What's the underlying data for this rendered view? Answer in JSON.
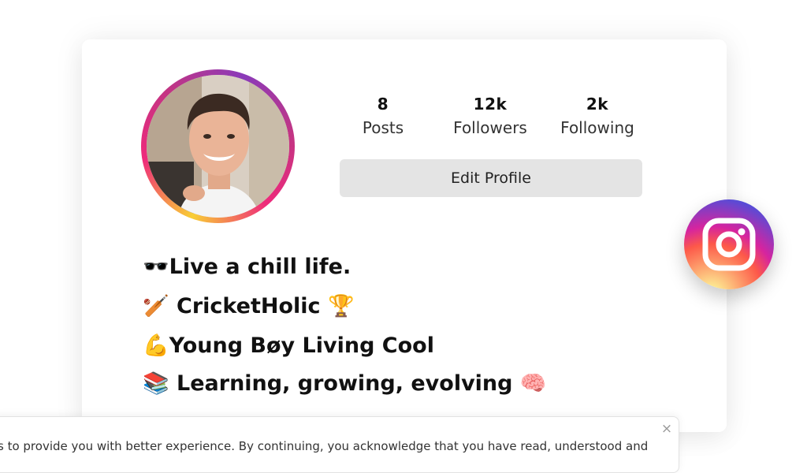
{
  "profile": {
    "stats": [
      {
        "value": "8",
        "label": "Posts"
      },
      {
        "value": "12k",
        "label": "Followers"
      },
      {
        "value": "2k",
        "label": "Following"
      }
    ],
    "edit_button_label": "Edit Profile",
    "bio": [
      {
        "emoji": "🕶️",
        "text": "Live a chill life."
      },
      {
        "emoji": "🏏",
        "text": " CricketHolic ",
        "trailing_emoji": "🏆"
      },
      {
        "emoji": "💪",
        "text": "Young Bøy Living Cool"
      },
      {
        "emoji": "📚",
        "text": " Learning, growing, evolving ",
        "trailing_emoji": "🧠"
      }
    ]
  },
  "instagram_badge": {
    "icon": "instagram-logo-icon",
    "gradient": [
      "#fdf497",
      "#fd5949",
      "#d6249f",
      "#285AEB"
    ]
  },
  "cookie_banner": {
    "text": "s to provide you with better experience. By continuing, you acknowledge that you have read, understood and",
    "close_symbol": "×"
  }
}
